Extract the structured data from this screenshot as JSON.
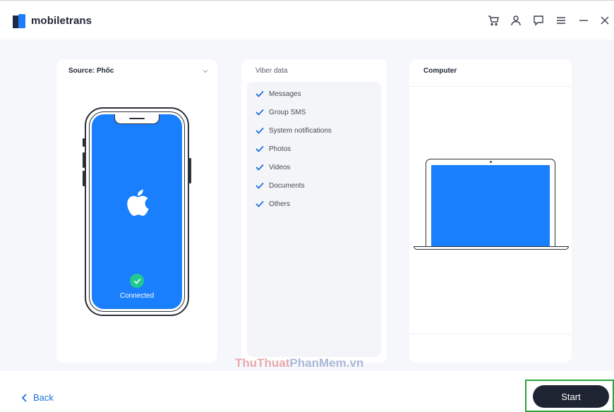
{
  "app": {
    "name": "mobiletrans",
    "brand_colors": {
      "dark": "#1f2b46",
      "blue": "#1f7dfd"
    }
  },
  "titlebar": {
    "icons": [
      "cart-icon",
      "account-icon",
      "feedback-icon",
      "menu-icon",
      "minimize-icon",
      "close-icon"
    ]
  },
  "source": {
    "title": "Source: Phốc",
    "device_status": "Connected",
    "screen_color": "#1a7ffc"
  },
  "viber": {
    "title": "Viber data",
    "items": [
      {
        "label": "Messages",
        "checked": true
      },
      {
        "label": "Group SMS",
        "checked": true
      },
      {
        "label": "System notifications",
        "checked": true
      },
      {
        "label": "Photos",
        "checked": true
      },
      {
        "label": "Videos",
        "checked": true
      },
      {
        "label": "Documents",
        "checked": true
      },
      {
        "label": "Others",
        "checked": true
      }
    ],
    "check_color": "#1f6fdb"
  },
  "destination": {
    "title": "Computer"
  },
  "watermark": {
    "part1": "ThuThuat",
    "part2": "PhanMem.vn"
  },
  "footer": {
    "back_label": "Back",
    "start_label": "Start",
    "highlight_color": "#2aa33b"
  }
}
